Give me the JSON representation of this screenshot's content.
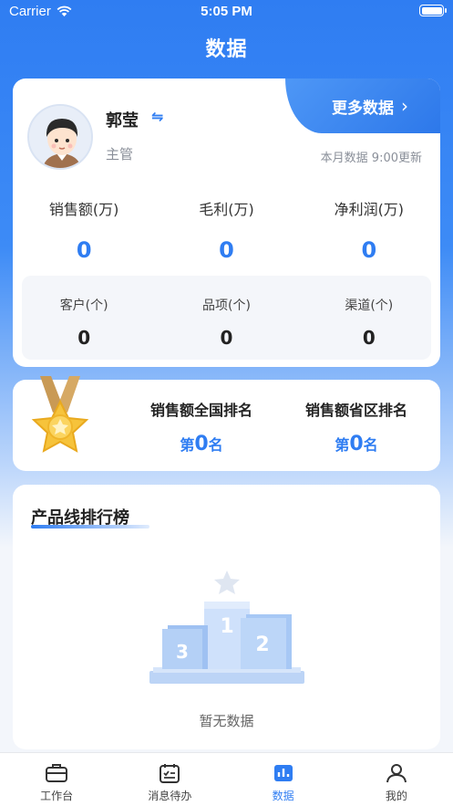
{
  "status_bar": {
    "carrier": "Carrier",
    "time": "5:05 PM"
  },
  "header": {
    "title": "数据"
  },
  "profile": {
    "name": "郭莹",
    "role": "主管",
    "more_label": "更多数据",
    "update_note": "本月数据 9:00更新"
  },
  "stats_primary": [
    {
      "label": "销售额(万)",
      "value": "0"
    },
    {
      "label": "毛利(万)",
      "value": "0"
    },
    {
      "label": "净利润(万)",
      "value": "0"
    }
  ],
  "stats_secondary": [
    {
      "label": "客户(个)",
      "value": "0"
    },
    {
      "label": "品项(个)",
      "value": "0"
    },
    {
      "label": "渠道(个)",
      "value": "0"
    }
  ],
  "ranking": {
    "national_title": "销售额全国排名",
    "provincial_title": "销售额省区排名",
    "prefix": "第",
    "suffix": "名",
    "national_value": "0",
    "provincial_value": "0"
  },
  "product_line": {
    "title": "产品线排行榜",
    "empty_text": "暂无数据",
    "podium": {
      "first": "1",
      "second": "2",
      "third": "3"
    }
  },
  "tabbar": [
    {
      "label": "工作台",
      "icon": "briefcase-icon"
    },
    {
      "label": "消息待办",
      "icon": "calendar-checklist-icon"
    },
    {
      "label": "数据",
      "icon": "data-icon"
    },
    {
      "label": "我的",
      "icon": "profile-icon"
    }
  ],
  "colors": {
    "accent": "#2f7df2",
    "background": "#f3f6fb"
  }
}
